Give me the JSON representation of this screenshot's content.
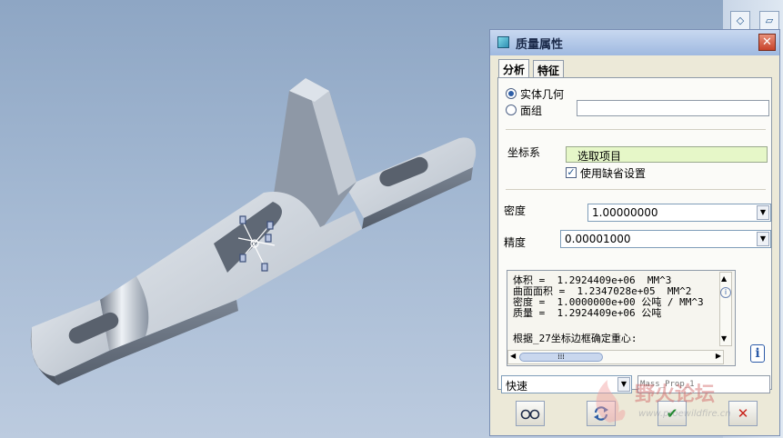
{
  "dialog": {
    "title": "质量属性",
    "close_label": "✕",
    "tabs": [
      {
        "label": "分析",
        "active": true
      },
      {
        "label": "特征",
        "active": false
      }
    ],
    "geometry": {
      "options": [
        {
          "label": "实体几何",
          "selected": true
        },
        {
          "label": "面组",
          "selected": false
        }
      ],
      "quilt_value": ""
    },
    "csys": {
      "label": "坐标系",
      "select_button": "选取项目",
      "use_default_label": "使用缺省设置",
      "use_default_checked": true
    },
    "density": {
      "label": "密度",
      "value": "1.00000000"
    },
    "accuracy": {
      "label": "精度",
      "value": "0.00001000"
    },
    "results": [
      "体积 =  1.2924409e+06  MM^3",
      "曲面面积 =  1.2347028e+05  MM^2",
      "密度 =  1.0000000e+00 公吨 / MM^3",
      "质量 =  1.2924409e+06 公吨",
      "",
      "根据_27坐标边框确定重心:"
    ],
    "mode": {
      "value": "快速"
    },
    "name_field": {
      "placeholder": "Mass_Prop_1"
    },
    "footer_buttons": {
      "preview_icon": "glasses-icon",
      "repaint_icon": "regenerate-icon",
      "ok_icon": "check-icon",
      "cancel_icon": "cross-icon",
      "ok_glyph": "✔",
      "cancel_glyph": "✕"
    }
  },
  "watermark": {
    "text": "野火论坛",
    "url_text": "www.proewildfire.cn"
  },
  "colors": {
    "viewport_top": "#8ea6c4",
    "viewport_bottom": "#bccbdf",
    "accent": "#2e5ea6",
    "select_green": "#e6f7c8"
  }
}
